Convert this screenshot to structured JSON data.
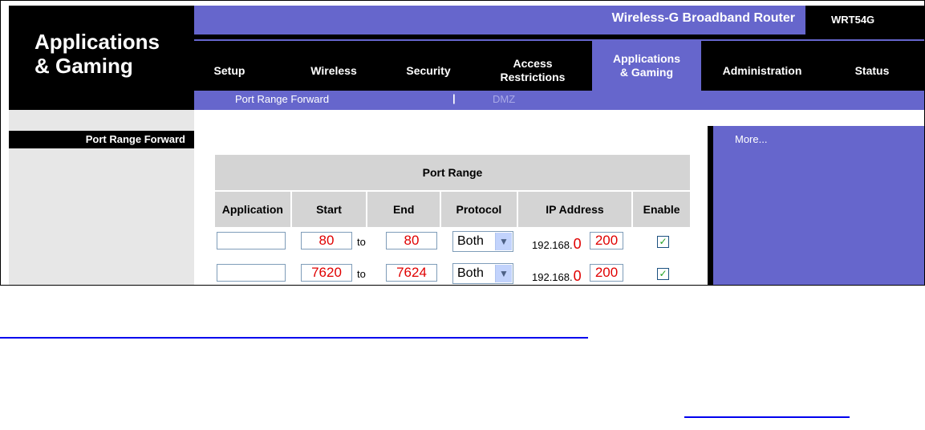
{
  "header": {
    "section_title": "Applications\n& Gaming",
    "product_name": "Wireless-G Broadband Router",
    "model": "WRT54G"
  },
  "tabs": [
    {
      "label": "Setup",
      "active": false
    },
    {
      "label": "Wireless",
      "active": false
    },
    {
      "label": "Security",
      "active": false
    },
    {
      "label": "Access\nRestrictions",
      "active": false
    },
    {
      "label": "Applications\n& Gaming",
      "active": true
    },
    {
      "label": "Administration",
      "active": false
    },
    {
      "label": "Status",
      "active": false
    }
  ],
  "subnav": {
    "item1": "Port Range Forward",
    "separator": "|",
    "item2": "DMZ"
  },
  "sidebar": {
    "label": "Port Range Forward"
  },
  "table": {
    "title": "Port Range",
    "columns": [
      "Application",
      "Start",
      "End",
      "Protocol",
      "IP Address",
      "Enable"
    ],
    "to_label": "to",
    "rows": [
      {
        "application": "",
        "start": "80",
        "end": "80",
        "protocol": "Both",
        "ip_prefix": "192.168.",
        "ip_third": "0",
        "ip_last": "200",
        "enabled": "✓"
      },
      {
        "application": "",
        "start": "7620",
        "end": "7624",
        "protocol": "Both",
        "ip_prefix": "192.168.",
        "ip_third": "0",
        "ip_last": "200",
        "enabled": "✓"
      }
    ]
  },
  "help": {
    "more_link": "More..."
  },
  "colors": {
    "accent": "#6666cc",
    "dark": "#000000",
    "header_gray": "#d4d4d4",
    "value_red": "#e00000",
    "link_blue": "#0000ee"
  }
}
